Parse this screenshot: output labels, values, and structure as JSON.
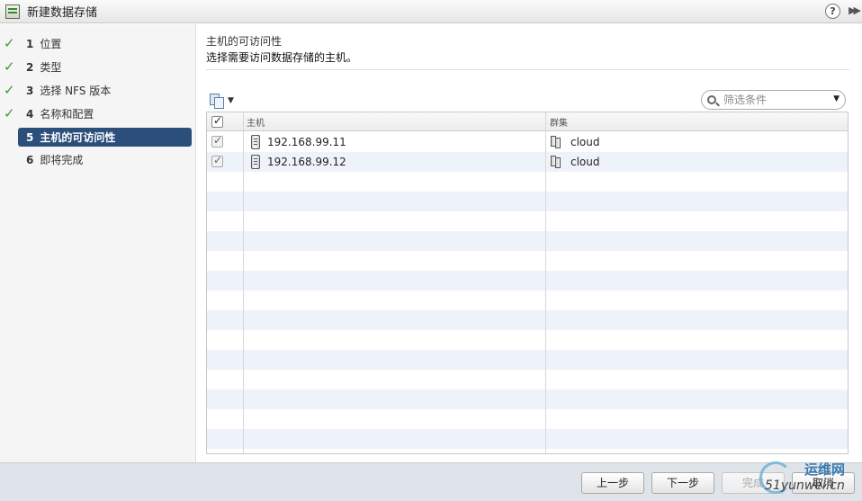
{
  "window": {
    "title": "新建数据存储",
    "help_label": "?",
    "expand_label": "▶▶"
  },
  "steps": [
    {
      "num": "1",
      "label": "位置",
      "done": true
    },
    {
      "num": "2",
      "label": "类型",
      "done": true
    },
    {
      "num": "3",
      "label": "选择 NFS 版本",
      "done": true
    },
    {
      "num": "4",
      "label": "名称和配置",
      "done": true
    },
    {
      "num": "5",
      "label": "主机的可访问性",
      "active": true
    },
    {
      "num": "6",
      "label": "即将完成"
    }
  ],
  "main": {
    "title": "主机的可访问性",
    "subtitle": "选择需要访问数据存储的主机。"
  },
  "filter": {
    "placeholder": "筛选条件"
  },
  "grid": {
    "columns": [
      "主机",
      "群集"
    ],
    "rows": [
      {
        "host": "192.168.99.11",
        "cluster": "cloud",
        "checked": true
      },
      {
        "host": "192.168.99.12",
        "cluster": "cloud",
        "checked": true
      }
    ]
  },
  "footer": {
    "back": "上一步",
    "next": "下一步",
    "finish": "完成",
    "cancel": "取消"
  },
  "watermark": {
    "top": "运维网",
    "bottom": "51yunwei.cn"
  },
  "colors": {
    "active_step": "#2b4e7a",
    "check": "#3d9b35",
    "row_alt": "#eef3fb",
    "footer": "#dfe4ea"
  }
}
